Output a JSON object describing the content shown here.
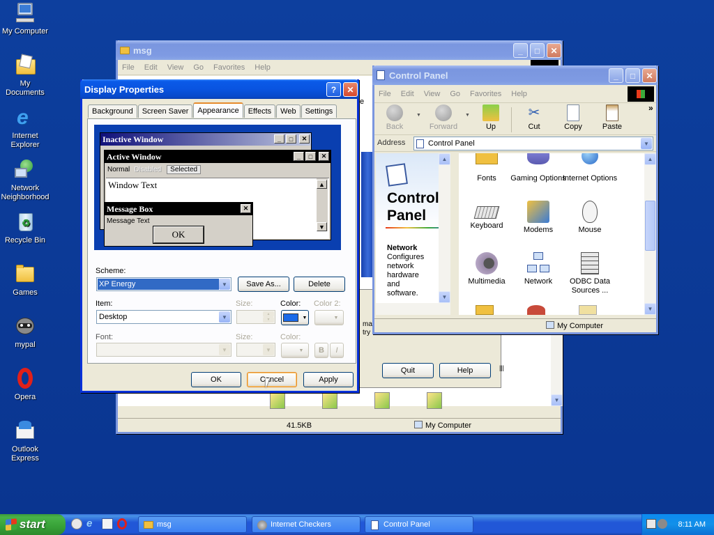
{
  "desktop": {
    "icons": [
      {
        "label": "My Computer"
      },
      {
        "label": "My Documents"
      },
      {
        "label": "Internet Explorer"
      },
      {
        "label": "Network Neighborhood"
      },
      {
        "label": "Recycle Bin"
      },
      {
        "label": "Games"
      },
      {
        "label": "mypal"
      },
      {
        "label": "Opera"
      },
      {
        "label": "Outlook Express"
      }
    ]
  },
  "msg_window": {
    "title": "msg",
    "menu": [
      "File",
      "Edit",
      "View",
      "Go",
      "Favorites",
      "Help"
    ],
    "status_size": "41.5KB",
    "status_location": "My Computer",
    "inner_dialog": {
      "text1": "ma",
      "text2": "try to",
      "quit": "Quit",
      "help": "Help",
      "partial_e": "e"
    }
  },
  "display_properties": {
    "title": "Display Properties",
    "tabs": [
      "Background",
      "Screen Saver",
      "Appearance",
      "Effects",
      "Web",
      "Settings"
    ],
    "selected_tab": "Appearance",
    "preview": {
      "inactive_title": "Inactive Window",
      "active_title": "Active Window",
      "menu_normal": "Normal",
      "menu_disabled": "Disabled",
      "menu_selected": "Selected",
      "window_text": "Window Text",
      "msgbox_title": "Message Box",
      "msgbox_text": "Message Text",
      "ok": "OK"
    },
    "scheme_label": "Scheme:",
    "scheme_value": "XP Energy",
    "save_as": "Save As...",
    "delete": "Delete",
    "item_label": "Item:",
    "item_value": "Desktop",
    "size_label": "Size:",
    "color_label": "Color:",
    "color2_label": "Color 2:",
    "font_label": "Font:",
    "font_size_label": "Size:",
    "font_color_label": "Color:",
    "bold": "B",
    "italic": "I",
    "ok": "OK",
    "cancel": "Cancel",
    "apply": "Apply",
    "item_color": "#1a6ae8"
  },
  "control_panel": {
    "title": "Control Panel",
    "menu": [
      "File",
      "Edit",
      "View",
      "Go",
      "Favorites",
      "Help"
    ],
    "toolbar": {
      "back": "Back",
      "forward": "Forward",
      "up": "Up",
      "cut": "Cut",
      "copy": "Copy",
      "paste": "Paste",
      "more": "»"
    },
    "address_label": "Address",
    "address_value": "Control Panel",
    "side_title_1": "Control",
    "side_title_2": "Panel",
    "side_heading": "Network",
    "side_desc_lines": [
      "Configures",
      "network",
      "hardware",
      "and",
      "software."
    ],
    "items": [
      {
        "label": "Fonts"
      },
      {
        "label": "Gaming Options"
      },
      {
        "label": "Internet Options"
      },
      {
        "label": "Keyboard"
      },
      {
        "label": "Modems"
      },
      {
        "label": "Mouse"
      },
      {
        "label": "Multimedia"
      },
      {
        "label": "Network"
      },
      {
        "label": "ODBC Data Sources ..."
      }
    ],
    "status_location": "My Computer"
  },
  "taskbar": {
    "start": "start",
    "tasks": [
      {
        "label": "msg"
      },
      {
        "label": "Internet Checkers"
      },
      {
        "label": "Control Panel"
      }
    ],
    "clock": "8:11 AM"
  }
}
